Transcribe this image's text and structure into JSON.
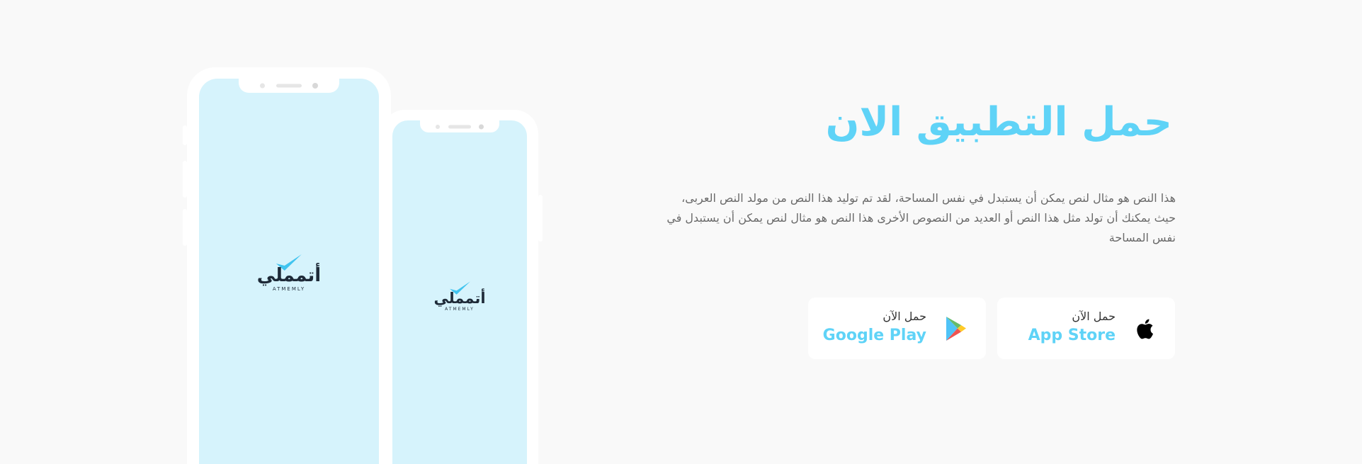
{
  "colors": {
    "background": "#f9f9f9",
    "accent": "#5fd3f7",
    "phone_frame": "#ffffff",
    "phone_screen": "#d6f3fc",
    "body_text": "#6a6a6a"
  },
  "phones": {
    "large": {
      "logo_ar": "أتمملي",
      "logo_en": "ATMEMLY"
    },
    "small": {
      "logo_ar": "أتمملي",
      "logo_en": "ATMEMLY"
    }
  },
  "hero": {
    "heading": "حمل التطبيق الان",
    "description": "هذا النص هو مثال لنص يمكن أن يستبدل في نفس المساحة، لقد تم توليد هذا النص من مولد النص العربى، حيث يمكنك أن تولد مثل هذا النص أو العديد من النصوص الأخرى هذا النص هو مثال لنص يمكن أن يستبدل في نفس المساحة"
  },
  "store_buttons": {
    "app_store": {
      "caption": "حمل الآن",
      "store": "App Store",
      "icon": "apple-icon"
    },
    "google_play": {
      "caption": "حمل الآن",
      "store": "Google Play",
      "icon": "google-play-icon"
    }
  }
}
